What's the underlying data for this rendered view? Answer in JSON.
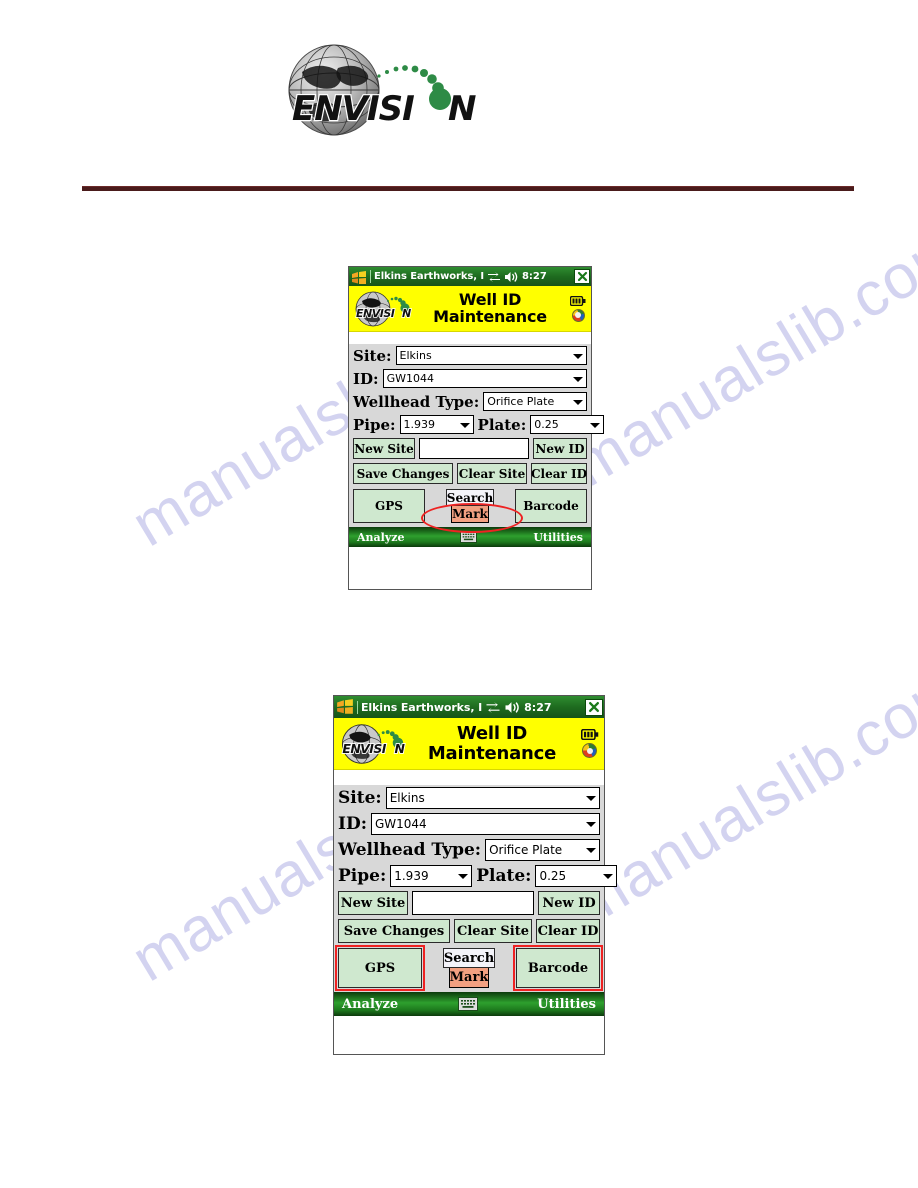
{
  "page": {
    "logo_text": "ENVISION",
    "watermark_text": "manualslib.com",
    "rule_color": "#4a1b1b"
  },
  "screenshots": [
    {
      "id": "screenshot-mark-highlight",
      "titlebar": {
        "start_icon": "windows-flag-icon",
        "title": "Elkins Earthworks, I",
        "network_icon": "network-connection-icon",
        "volume_icon": "speaker-volume-icon",
        "time": "8:27",
        "close_label": "✕"
      },
      "header": {
        "logo_text": "ENVISION",
        "title_line1": "Well ID",
        "title_line2": "Maintenance",
        "battery_icon": "battery-icon",
        "help_icon": "help-orb-icon"
      },
      "form": {
        "site_label": "Site:",
        "site_value": "Elkins",
        "id_label": "ID:",
        "id_value": "GW1044",
        "wellhead_label": "Wellhead Type:",
        "wellhead_value": "Orifice Plate",
        "pipe_label": "Pipe:",
        "pipe_value": "1.939",
        "plate_label": "Plate:",
        "plate_value": "0.25",
        "new_site_label": "New Site",
        "new_site_input_value": "",
        "new_id_label": "New ID",
        "save_changes_label": "Save Changes",
        "clear_site_label": "Clear Site",
        "clear_id_label": "Clear ID",
        "gps_label": "GPS",
        "search_label": "Search",
        "mark_label": "Mark",
        "barcode_label": "Barcode"
      },
      "taskbar": {
        "left_label": "Analyze",
        "center_icon": "keyboard-icon",
        "right_label": "Utilities"
      },
      "highlight": {
        "style": "ellipse",
        "targets": [
          "mark-button"
        ],
        "color": "#ee2222"
      }
    },
    {
      "id": "screenshot-gps-barcode-highlight",
      "titlebar": {
        "start_icon": "windows-flag-icon",
        "title": "Elkins Earthworks, I",
        "network_icon": "network-connection-icon",
        "volume_icon": "speaker-volume-icon",
        "time": "8:27",
        "close_label": "✕"
      },
      "header": {
        "logo_text": "ENVISION",
        "title_line1": "Well ID",
        "title_line2": "Maintenance",
        "battery_icon": "battery-icon",
        "help_icon": "help-orb-icon"
      },
      "form": {
        "site_label": "Site:",
        "site_value": "Elkins",
        "id_label": "ID:",
        "id_value": "GW1044",
        "wellhead_label": "Wellhead Type:",
        "wellhead_value": "Orifice Plate",
        "pipe_label": "Pipe:",
        "pipe_value": "1.939",
        "plate_label": "Plate:",
        "plate_value": "0.25",
        "new_site_label": "New Site",
        "new_site_input_value": "",
        "new_id_label": "New ID",
        "save_changes_label": "Save Changes",
        "clear_site_label": "Clear Site",
        "clear_id_label": "Clear ID",
        "gps_label": "GPS",
        "search_label": "Search",
        "mark_label": "Mark",
        "barcode_label": "Barcode"
      },
      "taskbar": {
        "left_label": "Analyze",
        "center_icon": "keyboard-icon",
        "right_label": "Utilities"
      },
      "highlight": {
        "style": "rectangle",
        "targets": [
          "gps-button",
          "barcode-button"
        ],
        "color": "#ee2222"
      }
    }
  ]
}
